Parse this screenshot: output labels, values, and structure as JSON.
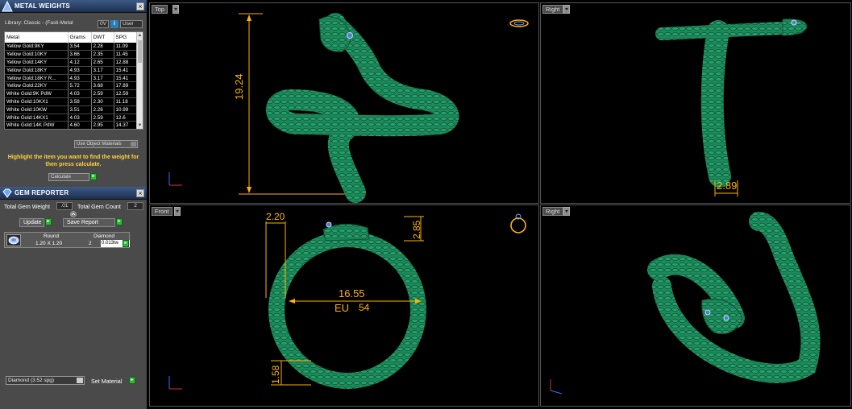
{
  "metal_weights": {
    "title": "METAL WEIGHTS",
    "library": "Library: Classic - (Fasti-Metal",
    "unit_left": "0V",
    "unit_right": "User",
    "info": "i",
    "columns": [
      "Metal",
      "Grams",
      "DWT",
      "SPG"
    ],
    "rows": [
      [
        "Yellow Gold:9KY",
        "3.54",
        "2.28",
        "11.09"
      ],
      [
        "Yellow Gold:10KY",
        "3.66",
        "2.35",
        "11.45"
      ],
      [
        "Yellow Gold:14KY",
        "4.12",
        "2.65",
        "12.88"
      ],
      [
        "Yellow Gold:18KY",
        "4.93",
        "3.17",
        "15.41"
      ],
      [
        "Yellow Gold:18KY R...",
        "4.93",
        "3.17",
        "15.41"
      ],
      [
        "Yellow Gold:22KY",
        "5.72",
        "3.68",
        "17.89"
      ],
      [
        "White Gold:9K PdW",
        "4.03",
        "2.59",
        "12.59"
      ],
      [
        "White Gold:10KX1",
        "3.58",
        "2.30",
        "11.18"
      ],
      [
        "White Gold:10KW",
        "3.51",
        "2.26",
        "10.99"
      ],
      [
        "White Gold:14KX1",
        "4.03",
        "2.59",
        "12.6"
      ],
      [
        "White Gold:14K PdW",
        "4.60",
        "2.95",
        "14.37"
      ]
    ],
    "use_object_materials": "Use Object Materials",
    "hint": "Highlight the item you want to find the weight for then press calculate.",
    "calculate": "Calculate"
  },
  "gem_reporter": {
    "title": "GEM REPORTER",
    "total_gem_weight_label": "Total Gem Weight",
    "total_gem_weight": ".01",
    "total_gem_count_label": "Total Gem Count",
    "total_gem_count": "2",
    "update": "Update",
    "save_report": "Save Report",
    "gem": {
      "shape": "Round",
      "size": "1.20 X 1.20",
      "type": "Diamond",
      "count": "2",
      "weight": "0.013tw"
    },
    "material_select": "Diamond      (3.52 spg)",
    "set_material": "Set Material"
  },
  "viewports": {
    "top": {
      "label": "Top",
      "dim_height": "19.24"
    },
    "right_top": {
      "label": "Right",
      "dim_width": "2.89"
    },
    "front": {
      "label": "Front",
      "dim_shank": "2.20",
      "dim_head": "2.85",
      "dim_bottom": "1.58",
      "inner_diameter": "16.55",
      "size_label": "EU",
      "size_value": "54"
    },
    "right_bottom": {
      "label": "Right"
    }
  },
  "colors": {
    "model_green": "#1d8a5c",
    "dimension": "#ffb400",
    "panel_bg": "#4a4a4a",
    "header_blue": "#2c4670"
  }
}
